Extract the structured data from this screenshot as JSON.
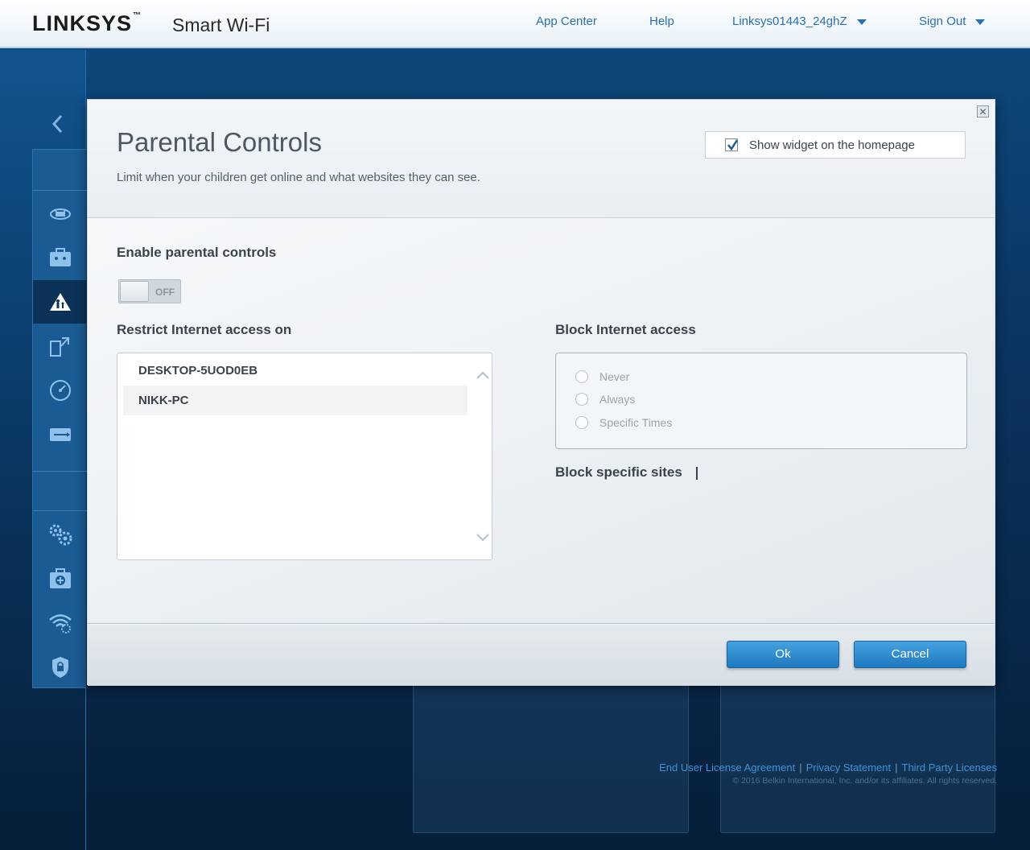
{
  "header": {
    "brand": "LINKSYS",
    "trademark": "™",
    "product": "Smart Wi-Fi",
    "nav": {
      "app_center": "App Center",
      "help": "Help",
      "network": "Linksys01443_24ghZ",
      "sign_out": "Sign Out"
    }
  },
  "sidebar": {
    "icons": [
      "back-arrow-icon",
      "network-map-icon",
      "guest-access-icon",
      "parental-controls-icon",
      "media-prioritization-icon",
      "speed-test-icon",
      "external-storage-icon",
      "connectivity-icon",
      "troubleshooting-icon",
      "wireless-icon",
      "security-icon"
    ],
    "active": "parental-controls-icon"
  },
  "modal": {
    "title": "Parental Controls",
    "subtitle": "Limit when your children get online and what websites they can see.",
    "show_widget_label": "Show widget on the homepage",
    "show_widget_checked": true,
    "close_glyph": "✕",
    "enable_label": "Enable parental controls",
    "toggle_state": "OFF",
    "restrict_label": "Restrict Internet access on",
    "devices": [
      "DESKTOP-5UOD0EB",
      "NIKK-PC"
    ],
    "block_label": "Block Internet access",
    "block_options": [
      "Never",
      "Always",
      "Specific Times"
    ],
    "block_sites_label": "Block specific sites",
    "ok_label": "Ok",
    "cancel_label": "Cancel"
  },
  "footer": {
    "links": [
      "End User License Agreement",
      "Privacy Statement",
      "Third Party Licenses"
    ],
    "copyright": "© 2016 Belkin International, Inc. and/or its affiliates. All rights reserved."
  },
  "colors": {
    "accent": "#2a6fb0",
    "button": "#2d8bd0",
    "background": "#0a3561"
  }
}
